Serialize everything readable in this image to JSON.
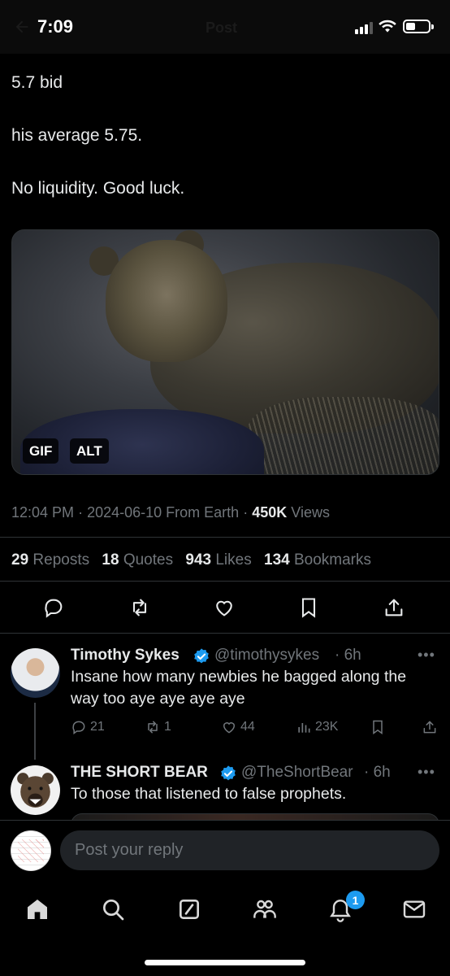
{
  "status_bar": {
    "time": "7:09",
    "header_label": "Post",
    "signal_icon": "signal-bars-icon",
    "wifi_icon": "wifi-icon",
    "battery_icon": "battery-icon"
  },
  "tweet": {
    "lines": [
      "5.7 bid",
      "his average 5.75.",
      "No liquidity. Good luck."
    ],
    "media": {
      "gif_badge": "GIF",
      "alt_badge": "ALT"
    },
    "meta": {
      "time": "12:04 PM",
      "date": "2024-06-10",
      "source": "From Earth",
      "views_count": "450K",
      "views_label": "Views",
      "sep": "·"
    },
    "stats": [
      {
        "count": "29",
        "label": "Reposts"
      },
      {
        "count": "18",
        "label": "Quotes"
      },
      {
        "count": "943",
        "label": "Likes"
      },
      {
        "count": "134",
        "label": "Bookmarks"
      }
    ],
    "actions": [
      "reply-icon",
      "repost-icon",
      "like-icon",
      "bookmark-icon",
      "share-icon"
    ]
  },
  "replies": [
    {
      "name": "Timothy Sykes",
      "handle": "@timothysykes",
      "time": "· 6h",
      "more": "•••",
      "text_lines": [
        "Insane how many newbies he bagged along the",
        "way too aye aye aye aye"
      ],
      "counts": {
        "replies": "21",
        "reposts": "1",
        "likes": "44",
        "views": "23K"
      }
    },
    {
      "name": "THE SHORT BEAR",
      "handle": "@TheShortBear",
      "time": "· 6h",
      "more": "•••",
      "text_lines": [
        "To those that listened to false prophets."
      ]
    }
  ],
  "reply_bar": {
    "placeholder": "Post your reply"
  },
  "tab_bar": {
    "tabs": [
      "home-icon",
      "search-icon",
      "grok-icon",
      "communities-icon",
      "notifications-icon",
      "messages-icon"
    ],
    "notifications_badge": "1"
  },
  "colors": {
    "accent": "#1d9bf0",
    "muted": "#71767b",
    "text": "#e7e9ea",
    "background": "#000000"
  }
}
